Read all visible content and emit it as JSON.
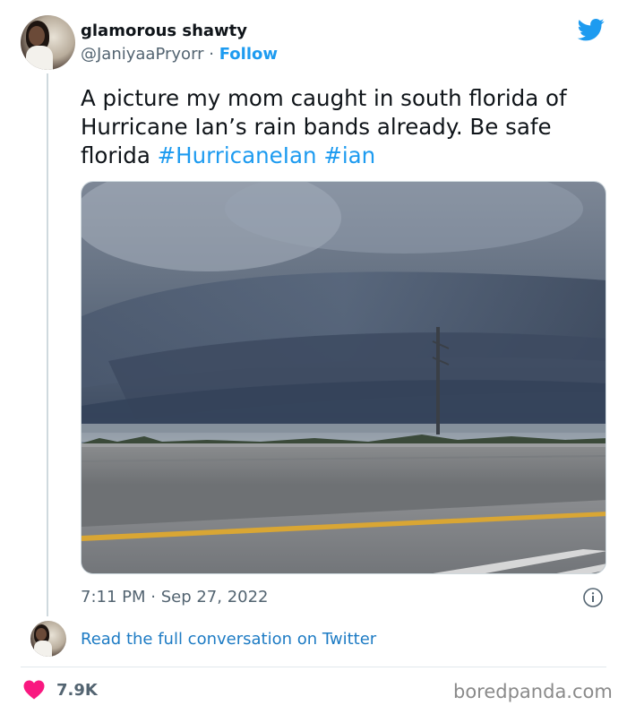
{
  "author": {
    "display_name": "glamorous shawty",
    "handle": "@JaniyaaPryorr",
    "separator": " · ",
    "follow_label": "Follow"
  },
  "tweet": {
    "text_plain": "A picture my mom caught in south florida of Hurricane Ian’s rain bands already. Be safe florida ",
    "hashtags": [
      "#HurricaneIan",
      "#ian"
    ],
    "timestamp": "7:11 PM · Sep 27, 2022"
  },
  "read_conversation_label": "Read the full conversation on Twitter",
  "likes_count": "7.9K",
  "watermark": "boredpanda.com",
  "icons": {
    "brand": "twitter-bird-icon",
    "info": "info-icon",
    "like": "heart-icon"
  },
  "colors": {
    "link_blue": "#1d9bf0",
    "secondary_text": "#536471",
    "heart_red": "#f91880"
  }
}
